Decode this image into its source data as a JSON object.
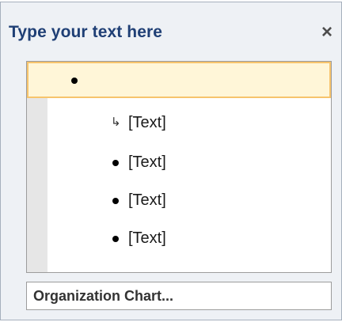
{
  "pane": {
    "title": "Type your text here",
    "close_icon": "close-icon",
    "close_glyph": "×"
  },
  "items": [
    {
      "level": 0,
      "marker": "bullet",
      "text": "",
      "selected": true
    },
    {
      "level": 1,
      "marker": "return-arrow",
      "text": "[Text]",
      "selected": false
    },
    {
      "level": 1,
      "marker": "bullet",
      "text": "[Text]",
      "selected": false
    },
    {
      "level": 1,
      "marker": "bullet",
      "text": "[Text]",
      "selected": false
    },
    {
      "level": 1,
      "marker": "bullet",
      "text": "[Text]",
      "selected": false
    }
  ],
  "footer": {
    "link_label": "Organization Chart..."
  },
  "colors": {
    "title": "#1f3f75",
    "selection_fill": "#fff6d8",
    "selection_border": "#f7c46c"
  }
}
